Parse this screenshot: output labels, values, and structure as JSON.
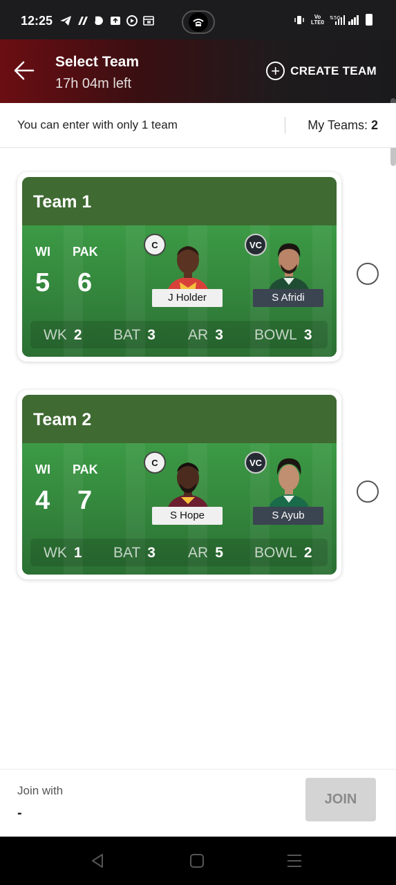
{
  "status_bar": {
    "time": "12:25",
    "left_icons": [
      "telegram-icon",
      "app-icon",
      "app-icon",
      "sync-icon",
      "youtube-icon",
      "calendar-icon"
    ],
    "right_icons": [
      "vibrate-icon",
      "volte-icon",
      "5g-icon",
      "signal-icon",
      "signal-icon",
      "battery-icon"
    ],
    "volte_top": "Vo",
    "volte_bottom": "LTE0"
  },
  "header": {
    "title": "Select Team",
    "time_left": "17h 04m left",
    "create_team_label": "CREATE TEAM"
  },
  "info": {
    "entry_note": "You can enter with only 1 team",
    "my_teams_label": "My Teams:",
    "my_teams_count": "2"
  },
  "teams": [
    {
      "name": "Team 1",
      "team_a": "WI",
      "team_a_count": "5",
      "team_b": "PAK",
      "team_b_count": "6",
      "captain_badge": "C",
      "captain_name": "J Holder",
      "vice_captain_badge": "VC",
      "vice_captain_name": "S Afridi",
      "stats": [
        {
          "label": "WK",
          "value": "2"
        },
        {
          "label": "BAT",
          "value": "3"
        },
        {
          "label": "AR",
          "value": "3"
        },
        {
          "label": "BOWL",
          "value": "3"
        }
      ]
    },
    {
      "name": "Team 2",
      "team_a": "WI",
      "team_a_count": "4",
      "team_b": "PAK",
      "team_b_count": "7",
      "captain_badge": "C",
      "captain_name": "S Hope",
      "vice_captain_badge": "VC",
      "vice_captain_name": "S Ayub",
      "stats": [
        {
          "label": "WK",
          "value": "1"
        },
        {
          "label": "BAT",
          "value": "3"
        },
        {
          "label": "AR",
          "value": "5"
        },
        {
          "label": "BOWL",
          "value": "2"
        }
      ]
    }
  ],
  "join": {
    "label": "Join with",
    "value": "-",
    "button": "JOIN"
  },
  "colors": {
    "header_red": "#6b0e12",
    "card_green": "#3c9a45",
    "join_disabled": "#d4d4d4"
  }
}
